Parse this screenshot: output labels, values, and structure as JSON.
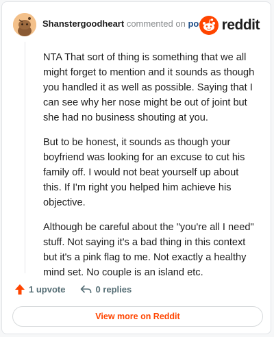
{
  "header": {
    "author": "Shanstergoodheart",
    "action_text": "commented on",
    "post_link": "post",
    "brand": "reddit"
  },
  "comment": {
    "paragraphs": [
      "NTA That sort of thing is something that we all might forget to mention and it sounds as though you handled it as well as possible. Saying that I can see why her nose might be out of joint but she had no business shouting at you.",
      "But to be honest, it sounds as though your boyfriend was looking for an excuse to cut his family off. I would not beat yourself up about this. If I'm right you helped him achieve his objective.",
      "Although be careful about the \"you're all I need\" stuff. Not saying it's a bad thing in this context but it's a pink flag to me. Not exactly a healthy mind set. No couple is an island etc."
    ]
  },
  "actions": {
    "upvote_label": "1 upvote",
    "replies_label": "0 replies"
  },
  "footer": {
    "view_more_label": "View more on Reddit"
  },
  "icons": {
    "upvote": "upvote-arrow-icon",
    "reply": "reply-arrow-icon",
    "brand": "reddit-snoo-icon"
  },
  "colors": {
    "brand_orange": "#ff4500",
    "post_link": "#1e4e87",
    "upvote_arrow": "#ff4500"
  }
}
